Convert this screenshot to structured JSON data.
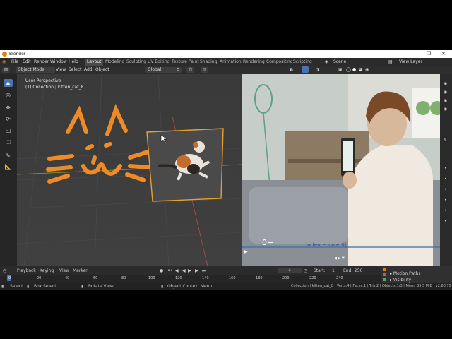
{
  "app_title": "Blender",
  "window_controls": [
    "–",
    "❐",
    "✕"
  ],
  "menu": [
    "File",
    "Edit",
    "Render",
    "Window",
    "Help"
  ],
  "workspace_tabs": [
    "Layout",
    "Modeling",
    "Sculpting",
    "UV Editing",
    "Texture Paint",
    "Shading",
    "Animation",
    "Rendering",
    "Compositing",
    "Scripting"
  ],
  "active_tab": "Layout",
  "add_tab": "+",
  "scene_label": "Scene",
  "view_layer_label": "View Layer",
  "header": {
    "mode": "Object Mode",
    "view": "View",
    "select": "Select",
    "add": "Add",
    "object": "Object",
    "transform": "Global"
  },
  "viewport": {
    "line1": "User Perspective",
    "line2": "(1) Collection | kitten_cat_8"
  },
  "video_overlay": {
    "counter": "0+",
    "scribble": "|orfenrenon etti|",
    "mini": "◀ ▶ ▼"
  },
  "timeline": {
    "playback": "Playback",
    "keying": "Keying",
    "view": "View",
    "marker": "Marker",
    "current_frame": "1",
    "start_label": "Start:",
    "start": "1",
    "end_label": "End:",
    "end": "250",
    "ruler": [
      "0",
      "20",
      "40",
      "60",
      "80",
      "100",
      "120",
      "140",
      "160",
      "180",
      "200",
      "220",
      "240"
    ]
  },
  "properties": {
    "motion_paths": "Motion Paths",
    "visibility": "Visibility"
  },
  "status": {
    "select": "Select",
    "box_select": "Box Select",
    "rotate_view": "Rotate View",
    "context_menu": "Object Context Menu",
    "info": "Collection | kitten_cat_8 | Verts:4 | Faces:1 | Tris:2 | Objects:1/3 | Mem: 35.5 MiB | v2.80.75"
  },
  "colors": {
    "accent_orange": "#f08a24",
    "selection": "#e8a030",
    "active_tool": "#4772b3"
  },
  "icons": {
    "cursor": "select-arrow-icon",
    "move": "move-icon",
    "rotate": "rotate-icon",
    "scale": "scale-icon",
    "transform": "transform-icon",
    "annotate": "annotate-icon",
    "measure": "measure-icon"
  }
}
